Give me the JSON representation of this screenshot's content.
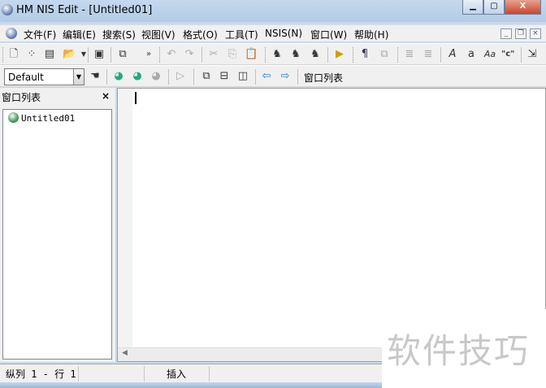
{
  "window": {
    "title": "HM NIS Edit - [Untitled01]",
    "min": "▁",
    "max": "▢",
    "close": "X"
  },
  "menu": [
    "文件(F)",
    "编辑(E)",
    "搜索(S)",
    "视图(V)",
    "格式(O)",
    "工具(T)",
    "NSIS(N)",
    "窗口(W)",
    "帮助(H)"
  ],
  "mdi": {
    "min": "_",
    "restore": "❐",
    "close": "×"
  },
  "toolbar2": {
    "combo_value": "Default",
    "window_list_label": "窗口列表"
  },
  "panel": {
    "title": "窗口列表",
    "close": "×",
    "items": [
      "Untitled01"
    ]
  },
  "status": {
    "position": "纵列 1 - 行 1",
    "mode": "插入"
  },
  "watermark": "软件技巧"
}
